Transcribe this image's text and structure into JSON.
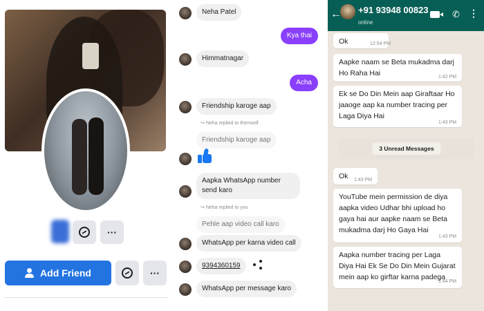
{
  "facebook": {
    "add_friend_label": "Add Friend",
    "more_label": "···"
  },
  "messenger": {
    "messages": {
      "m1": "Neha Patel",
      "m2": "Kya thai",
      "m3": "Himmatnagar",
      "m4": "Acha",
      "m5": "Friendship karoge aap",
      "m6_note": "Neha replied to themself",
      "m6": "Friendship karoge aap",
      "m7": "Aapka WhatsApp number send karo",
      "m8_note": "Neha replied to you",
      "m8": "Pehle aap video call karo",
      "m9": "WhatsApp per karna video call",
      "m10": "9394360159",
      "m11": "WhatsApp per message karo"
    }
  },
  "whatsapp": {
    "contact_name": "+91 93948 00823",
    "status": "online",
    "unread_label": "3 Unread Messages",
    "messages": {
      "w1": "Ok",
      "w1_time": "12:54 PM",
      "w2": "Aapke naam se Beta mukadma darj Ho Raha Hai",
      "w2_time": "1:42 PM",
      "w3": "Ek se Do Din Mein aap Giraftaar Ho jaaoge aap ka number tracing per Laga Diya Hai",
      "w3_time": "1:43 PM",
      "w4": "Ok",
      "w4_time": "1:43 PM",
      "w5": "YouTube mein permission de diya aapka video Udhar bhi upload ho gaya hai aur aapke naam se Beta mukadma darj Ho Gaya Hai",
      "w5_time": "1:43 PM",
      "w6": "Aapka number tracing per Laga Diya Hai Ek Se Do Din Mein Gujarat mein aap ko girftar karna padega",
      "w6_time": "1:44 PM"
    }
  },
  "colors": {
    "facebook_blue": "#2374e1",
    "messenger_purple": "#8a3ffc",
    "whatsapp_header": "#075e54",
    "whatsapp_bg": "#ece5dd"
  }
}
